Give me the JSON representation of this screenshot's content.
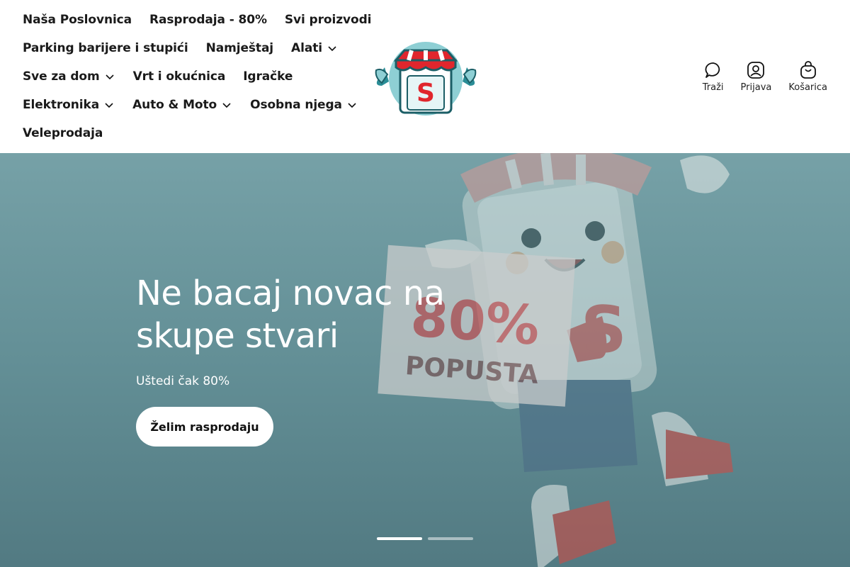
{
  "nav": {
    "rows": [
      [
        {
          "label": "Naša Poslovnica",
          "dropdown": false
        },
        {
          "label": "Rasprodaja - 80%",
          "dropdown": false
        },
        {
          "label": "Svi proizvodi",
          "dropdown": false
        }
      ],
      [
        {
          "label": "Parking barijere i stupići",
          "dropdown": false
        },
        {
          "label": "Namještaj",
          "dropdown": false
        },
        {
          "label": "Alati",
          "dropdown": true
        }
      ],
      [
        {
          "label": "Sve za dom",
          "dropdown": true
        },
        {
          "label": "Vrt i okućnica",
          "dropdown": false
        },
        {
          "label": "Igračke",
          "dropdown": false
        }
      ],
      [
        {
          "label": "Elektronika",
          "dropdown": true
        },
        {
          "label": "Auto & Moto",
          "dropdown": true
        },
        {
          "label": "Osobna njega",
          "dropdown": true
        }
      ],
      [
        {
          "label": "Veleprodaja",
          "dropdown": false
        }
      ]
    ]
  },
  "logo": {
    "letter": "S"
  },
  "actions": {
    "search": "Traži",
    "login": "Prijava",
    "cart": "Košarica"
  },
  "hero": {
    "title": "Ne bacaj novac na skupe stvari",
    "subtitle": "Uštedi čak 80%",
    "button": "Želim rasprodaju",
    "sign_percent": "80%",
    "sign_text": "POPUSTA",
    "body_letter": "S",
    "slides": 2,
    "active_slide": 1
  },
  "colors": {
    "hero_bg": "#6b979d",
    "accent_red": "#e0262d",
    "logo_teal": "#8ecfd4"
  }
}
